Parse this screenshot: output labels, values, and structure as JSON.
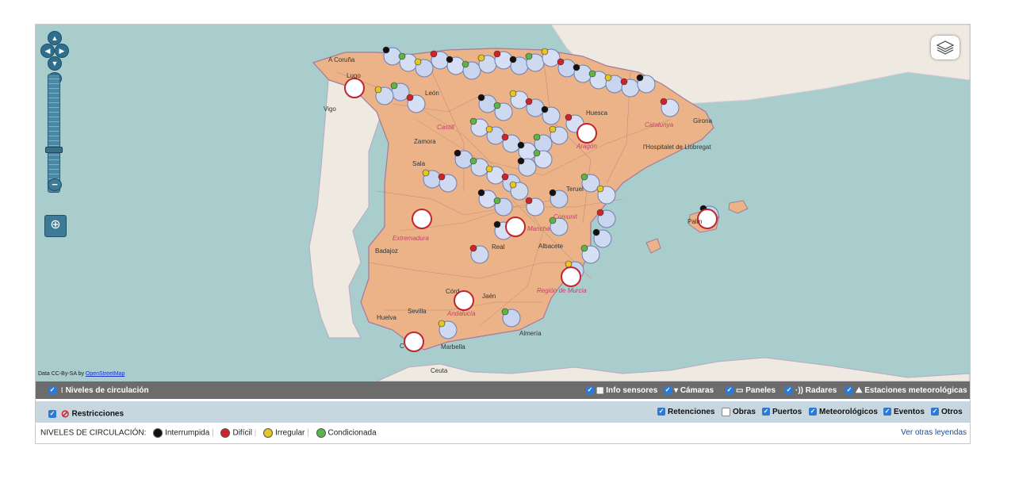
{
  "map": {
    "credit_prefix": "Data CC-By-SA by",
    "credit_link": "OpenStreetMap",
    "cities": [
      "A Coruña",
      "Lugo",
      "Vigo",
      "León",
      "Zamora",
      "Sala",
      "Huesca",
      "Girona",
      "l'Hospitalet de Llobregat",
      "Teruel",
      "Badajoz",
      "Real",
      "Albacete",
      "Córd",
      "Jaén",
      "Sevilla",
      "Huelva",
      "Marbella",
      "Almería",
      "Palm",
      "Ceuta",
      "C"
    ],
    "regions": [
      "Castill",
      "Aragón",
      "Catalunya",
      "Extremadura",
      "Comunit",
      "Mancha",
      "Región de Murcia",
      "Andalucía"
    ]
  },
  "layer_bar": {
    "niveles": "Niveles de circulación",
    "info_sensores": "Info sensores",
    "camaras": "Cámaras",
    "paneles": "Paneles",
    "radares": "Radares",
    "estaciones": "Estaciones meteorológicas"
  },
  "filter_bar": {
    "restricciones": "Restricciones",
    "retenciones": "Retenciones",
    "obras": "Obras",
    "puertos": "Puertos",
    "meteorologicos": "Meteorológicos",
    "eventos": "Eventos",
    "otros": "Otros"
  },
  "legend": {
    "title": "NIVELES DE CIRCULACIÓN:",
    "interrumpida": "Interrumpida",
    "dificil": "Difícil",
    "irregular": "Irregular",
    "condicionada": "Condicionada",
    "ver_otras": "Ver otras leyendas"
  },
  "colors": {
    "interrumpida": "#111111",
    "dificil": "#d0222a",
    "irregular": "#e6c623",
    "condicionada": "#5bb548",
    "spain_land": "#ecb388",
    "other_land": "#eeeae2",
    "sea": "#a9cccd"
  }
}
